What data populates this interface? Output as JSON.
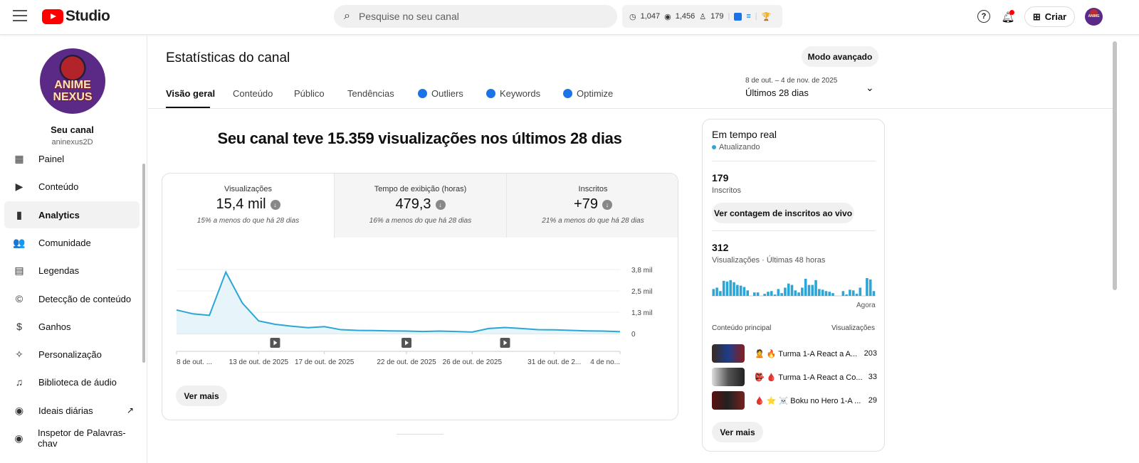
{
  "header": {
    "logo": "Studio",
    "search_placeholder": "Pesquise no seu canal",
    "stats": {
      "watch": "1,047",
      "views": "1,456",
      "subs": "179"
    },
    "create": "Criar",
    "avatar_text": "ANIME NEXUS"
  },
  "sidebar": {
    "avatar_text": "ANIME NEXUS",
    "channel_label": "Seu canal",
    "handle": "aninexus2D",
    "items": [
      {
        "label": "Painel",
        "icon": "dashboard-icon",
        "glyph": "▦"
      },
      {
        "label": "Conteúdo",
        "icon": "content-icon",
        "glyph": "▶"
      },
      {
        "label": "Analytics",
        "icon": "analytics-icon",
        "glyph": "▮"
      },
      {
        "label": "Comunidade",
        "icon": "community-icon",
        "glyph": "👥"
      },
      {
        "label": "Legendas",
        "icon": "subtitles-icon",
        "glyph": "▤"
      },
      {
        "label": "Detecção de conteúdo",
        "icon": "copyright-icon",
        "glyph": "©"
      },
      {
        "label": "Ganhos",
        "icon": "dollar-icon",
        "glyph": "$"
      },
      {
        "label": "Personalização",
        "icon": "magic-wand-icon",
        "glyph": "✧"
      },
      {
        "label": "Biblioteca de áudio",
        "icon": "audio-library-icon",
        "glyph": "♫"
      },
      {
        "label": "Ideais diárias",
        "icon": "vidiq-icon",
        "glyph": "◉"
      },
      {
        "label": "Inspetor de Palavras-chav",
        "icon": "vidiq-icon",
        "glyph": "◉"
      }
    ]
  },
  "page": {
    "title": "Estatísticas do canal",
    "advanced": "Modo avançado",
    "tabs": [
      "Visão geral",
      "Conteúdo",
      "Público",
      "Tendências",
      "Outliers",
      "Keywords",
      "Optimize"
    ],
    "date_range": "8 de out. – 4 de nov. de 2025",
    "date_label": "Últimos 28 dias",
    "headline": "Seu canal teve 15.359 visualizações nos últimos 28 dias",
    "metrics": [
      {
        "label": "Visualizações",
        "value": "15,4 mil",
        "compare": "15% a menos do que há 28 dias"
      },
      {
        "label": "Tempo de exibição (horas)",
        "value": "479,3",
        "compare": "16% a menos do que há 28 dias"
      },
      {
        "label": "Inscritos",
        "value": "+79",
        "compare": "21% a menos do que há 28 dias"
      }
    ],
    "see_more": "Ver mais"
  },
  "chart_data": {
    "type": "area",
    "title": "Visualizações",
    "ylim": [
      0,
      3800
    ],
    "y_ticks": [
      {
        "v": 3800,
        "label": "3,8 mil"
      },
      {
        "v": 2533,
        "label": "2,5 mil"
      },
      {
        "v": 1267,
        "label": "1,3 mil"
      },
      {
        "v": 0,
        "label": "0"
      }
    ],
    "x_labels": [
      {
        "i": 0,
        "label": "8 de out. ..."
      },
      {
        "i": 5,
        "label": "13 de out. de 2025"
      },
      {
        "i": 9,
        "label": "17 de out. de 2025"
      },
      {
        "i": 14,
        "label": "22 de out. de 2025"
      },
      {
        "i": 18,
        "label": "26 de out. de 2025"
      },
      {
        "i": 23,
        "label": "31 de out. de 2..."
      },
      {
        "i": 27,
        "label": "4 de no..."
      }
    ],
    "values": [
      1400,
      1170,
      1080,
      3650,
      1820,
      750,
      550,
      440,
      350,
      410,
      230,
      190,
      180,
      160,
      150,
      120,
      150,
      120,
      90,
      300,
      360,
      300,
      230,
      220,
      190,
      160,
      150,
      110
    ],
    "video_markers": [
      6,
      14,
      20
    ],
    "color": "#2ba6d6"
  },
  "realtime": {
    "title": "Em tempo real",
    "status": "Atualizando",
    "subs": "179",
    "subs_label": "Inscritos",
    "live_btn": "Ver contagem de inscritos ao vivo",
    "views": "312",
    "views_label": "Visualizações · Últimas 48 horas",
    "now": "Agora",
    "bars": [
      10,
      12,
      7,
      22,
      21,
      23,
      20,
      16,
      15,
      13,
      8,
      0,
      5,
      5,
      0,
      3,
      6,
      7,
      2,
      10,
      4,
      12,
      18,
      16,
      8,
      5,
      12,
      25,
      16,
      16,
      23,
      10,
      9,
      7,
      6,
      4,
      0,
      0,
      7,
      2,
      9,
      8,
      3,
      12,
      0,
      26,
      24,
      7
    ],
    "top_header": "Conteúdo principal",
    "top_views_header": "Visualizações",
    "top": [
      {
        "title": "🙎 🔥 Turma 1-A React a A...",
        "views": "203"
      },
      {
        "title": "👺 🩸 Turma 1-A React a Co...",
        "views": "33"
      },
      {
        "title": "🩸 ⭐ ☠️ Boku no Hero 1-A ...",
        "views": "29"
      }
    ],
    "see_more": "Ver mais"
  }
}
